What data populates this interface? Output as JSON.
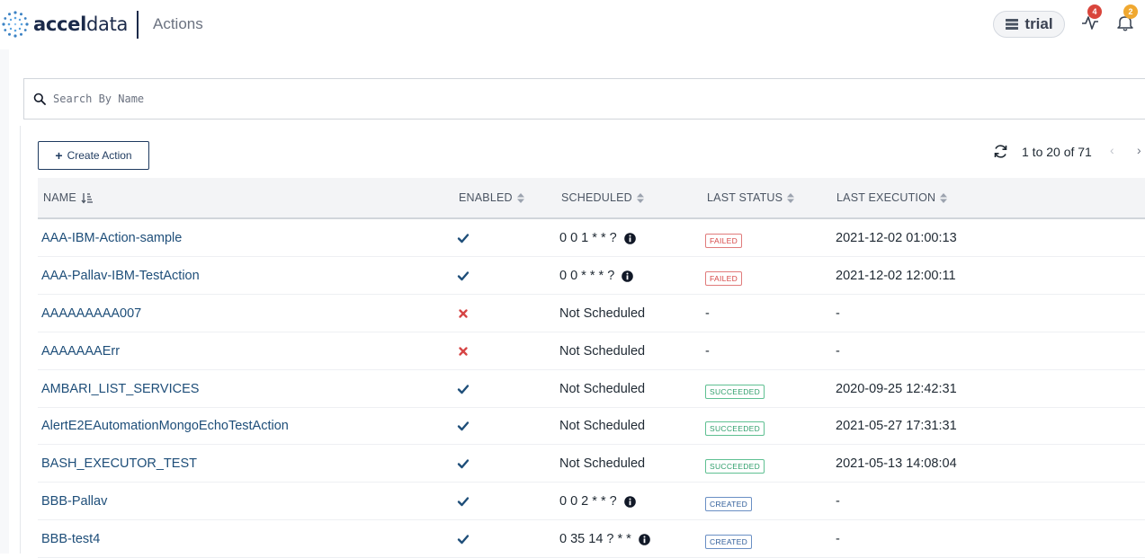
{
  "header": {
    "brand_bold": "accel",
    "brand_light": "data",
    "page_title": "Actions",
    "tenant": "trial",
    "alerts_count": "4",
    "notifications_count": "2"
  },
  "search": {
    "placeholder": "Search By Name"
  },
  "toolbar": {
    "create_label": "Create Action",
    "pagination": "1 to 20 of 71",
    "prev": "‹",
    "next": "›"
  },
  "table": {
    "columns": {
      "name": "NAME",
      "enabled": "ENABLED",
      "scheduled": "SCHEDULED",
      "last_status": "LAST STATUS",
      "last_execution": "LAST EXECUTION"
    },
    "rows": [
      {
        "name": "AAA-IBM-Action-sample",
        "enabled": true,
        "scheduled": "0 0 1 * * ?",
        "has_info": true,
        "status": "FAILED",
        "execution": "2021-12-02 01:00:13"
      },
      {
        "name": "AAA-Pallav-IBM-TestAction",
        "enabled": true,
        "scheduled": "0 0 * * * ?",
        "has_info": true,
        "status": "FAILED",
        "execution": "2021-12-02 12:00:11"
      },
      {
        "name": "AAAAAAAAA007",
        "enabled": false,
        "scheduled": "Not Scheduled",
        "has_info": false,
        "status": "-",
        "execution": "-"
      },
      {
        "name": "AAAAAAAErr",
        "enabled": false,
        "scheduled": "Not Scheduled",
        "has_info": false,
        "status": "-",
        "execution": "-"
      },
      {
        "name": "AMBARI_LIST_SERVICES",
        "enabled": true,
        "scheduled": "Not Scheduled",
        "has_info": false,
        "status": "SUCCEEDED",
        "execution": "2020-09-25 12:42:31"
      },
      {
        "name": "AlertE2EAutomationMongoEchoTestAction",
        "enabled": true,
        "scheduled": "Not Scheduled",
        "has_info": false,
        "status": "SUCCEEDED",
        "execution": "2021-05-27 17:31:31"
      },
      {
        "name": "BASH_EXECUTOR_TEST",
        "enabled": true,
        "scheduled": "Not Scheduled",
        "has_info": false,
        "status": "SUCCEEDED",
        "execution": "2021-05-13 14:08:04"
      },
      {
        "name": "BBB-Pallav",
        "enabled": true,
        "scheduled": "0 0 2 * * ?",
        "has_info": true,
        "status": "CREATED",
        "execution": "-"
      },
      {
        "name": "BBB-test4",
        "enabled": true,
        "scheduled": "0 35 14 ? * *",
        "has_info": true,
        "status": "CREATED",
        "execution": "-"
      }
    ]
  },
  "colors": {
    "brand_navy": "#1b2a4a",
    "link": "#1e4e79",
    "enabled_check": "#1e4e79",
    "disabled_cross": "#d64545",
    "failed": "#d64545",
    "succeeded": "#2f9e6b",
    "created": "#2e5c99",
    "alerts_badge": "#d9453b",
    "notifications_badge": "#f0a830"
  }
}
